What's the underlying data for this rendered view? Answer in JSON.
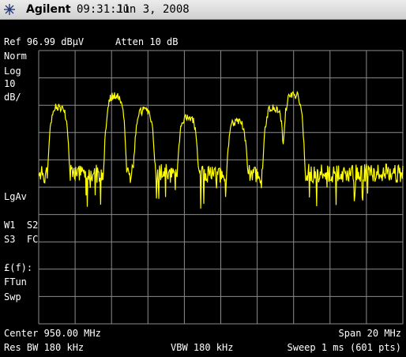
{
  "title_bar": {
    "brand": "Agilent",
    "time": "09:31:11",
    "date": "Jun 3, 2008",
    "icon": "agilent-spark-logo-icon"
  },
  "header": {
    "ref_level": "Ref 96.99 dBμV",
    "attenuation": "Atten 10 dB"
  },
  "left_annotations": {
    "norm": "Norm",
    "log": "Log",
    "scale_value": "10",
    "scale_unit": "dB/",
    "detector": "LgAv",
    "w1s2": "W1  S2",
    "s3fc": "S3  FC",
    "ff": "£(f):",
    "ftun": "FTun",
    "swp": "Swp"
  },
  "footer": {
    "center": "Center 950.00 MHz",
    "span": "Span 20 MHz",
    "res_bw": "Res BW 180 kHz",
    "vbw": "VBW 180 kHz",
    "sweep": "Sweep 1 ms (601 pts)"
  },
  "colors": {
    "background": "#000000",
    "grid": "#8c8c8c",
    "trace": "#ffff00",
    "text": "#ffffff"
  },
  "chart_data": {
    "type": "line",
    "title": "",
    "xlabel": "",
    "ylabel": "",
    "center_mhz": 950.0,
    "span_mhz": 20,
    "ref_level_dbuv": 96.99,
    "db_per_div": 10,
    "divisions": [
      10,
      10
    ],
    "grid": true,
    "peaks": [
      {
        "freq_mhz": 941.1,
        "level_dbuv": 76.3
      },
      {
        "freq_mhz": 944.2,
        "level_dbuv": 80.4
      },
      {
        "freq_mhz": 945.8,
        "level_dbuv": 75.0
      },
      {
        "freq_mhz": 948.2,
        "level_dbuv": 72.3
      },
      {
        "freq_mhz": 950.9,
        "level_dbuv": 71.0
      },
      {
        "freq_mhz": 952.9,
        "level_dbuv": 75.8
      },
      {
        "freq_mhz": 954.0,
        "level_dbuv": 80.6
      }
    ],
    "noise_floor_dbuv": 52
  }
}
